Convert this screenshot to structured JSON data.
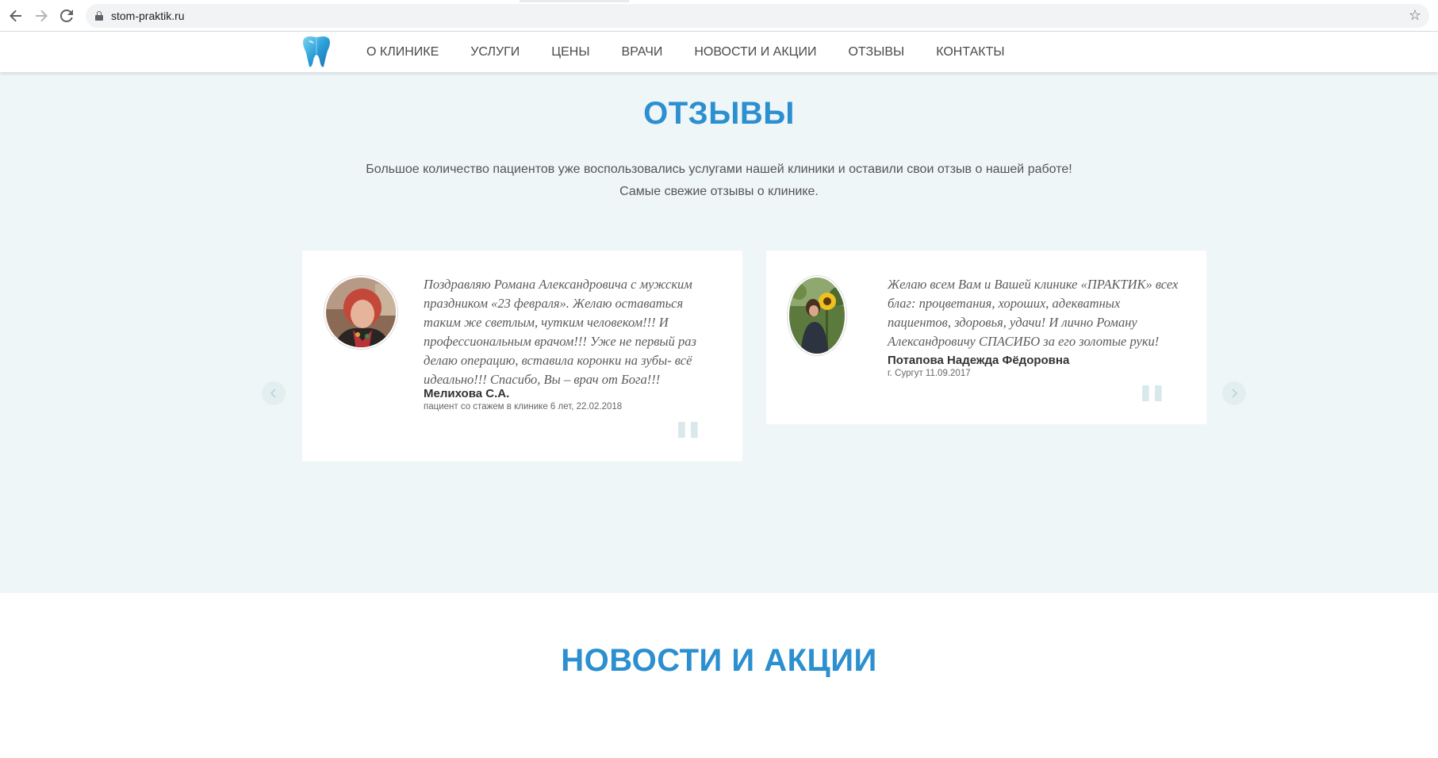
{
  "browser": {
    "url": "stom-praktik.ru",
    "back_icon": "arrow-left-icon",
    "forward_icon": "arrow-right-icon",
    "reload_icon": "reload-icon",
    "bookmark_icon": "star-icon"
  },
  "nav": {
    "items": [
      {
        "label": "О КЛИНИКЕ"
      },
      {
        "label": "УСЛУГИ"
      },
      {
        "label": "ЦЕНЫ"
      },
      {
        "label": "ВРАЧИ"
      },
      {
        "label": "НОВОСТИ И АКЦИИ"
      },
      {
        "label": "ОТЗЫВЫ"
      },
      {
        "label": "КОНТАКТЫ"
      }
    ]
  },
  "reviews": {
    "title": "ОТЗЫВЫ",
    "intro_line1": "Большое количество пациентов уже воспользовались услугами нашей клиники и оставили свои отзыв о нашей работе!",
    "intro_line2": "Самые свежие отзывы о клинике.",
    "items": [
      {
        "text": "Поздравляю Романа Александровича с мужским праздником «23 февраля». Желаю оставаться таким же светлым, чутким человеком!!! И профессиональным врачом!!! Уже не первый раз делаю операцию, вставила коронки на зубы- всё идеально!!! Спасибо, Вы – врач от Бога!!!",
        "author": "Мелихова С.А.",
        "meta": "пациент со стажем в клинике 6 лет, 22.02.2018"
      },
      {
        "text": "Желаю всем Вам и Вашей клинике «ПРАКТИК» всех благ: процветания, хороших, адекватных пациентов, здоровья, удачи! И лично Роману Александровичу СПАСИБО за его золотые руки!",
        "author": "Потапова Надежда Фёдоровна",
        "meta": "г. Сургут 11.09.2017"
      }
    ],
    "prev_icon": "chevron-left-icon",
    "next_icon": "chevron-right-icon"
  },
  "news": {
    "title": "НОВОСТИ И АКЦИИ"
  },
  "colors": {
    "accent": "#2b8fd0",
    "section_bg": "#eff6f7"
  }
}
